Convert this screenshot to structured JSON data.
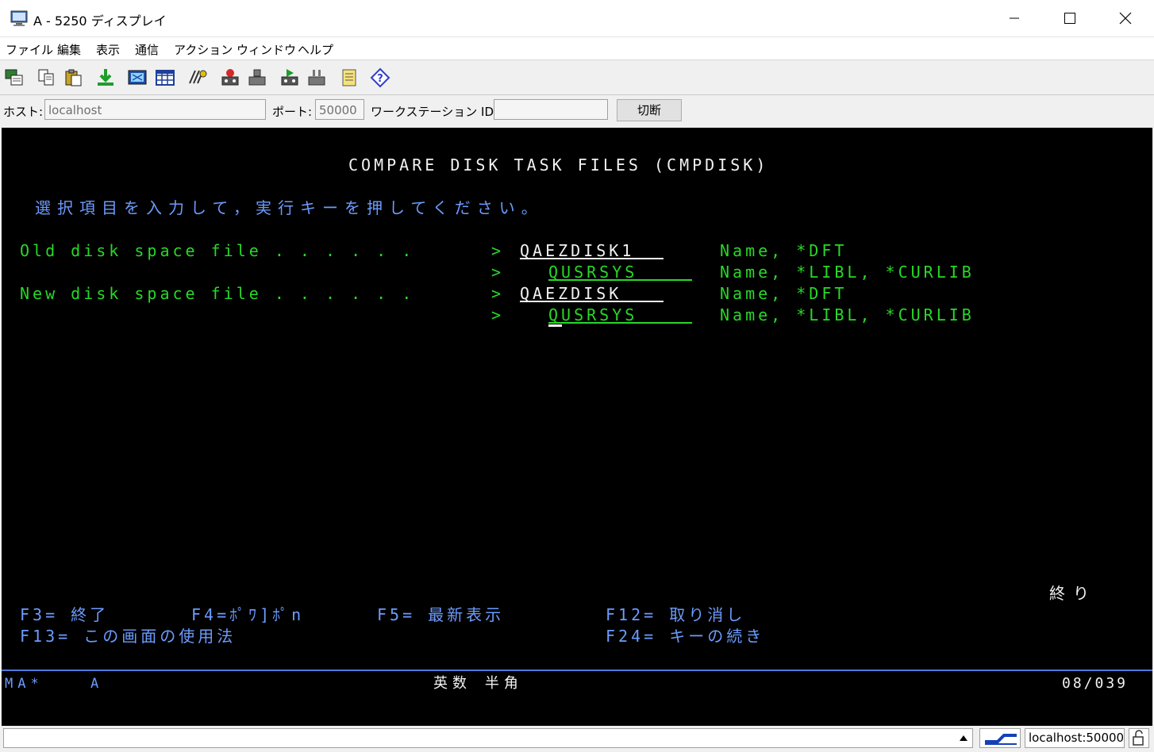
{
  "window": {
    "title": "A - 5250 ディスプレイ"
  },
  "menu": [
    "ファイル",
    "編集",
    "表示",
    "通信",
    "アクション",
    "ウィンドウ",
    "ヘルプ"
  ],
  "toolbar_icons": [
    "copy-screen-icon",
    "copy-icon",
    "paste-icon",
    "download-icon",
    "receive-icon",
    "grid-icon",
    "macro-icon",
    "record-icon",
    "stop-icon",
    "play-icon",
    "pause-icon",
    "notes-icon",
    "help-icon"
  ],
  "connection": {
    "host_label": "ホスト:",
    "host_value": "localhost",
    "port_label": "ポート:",
    "port_value": "50000",
    "ws_label": "ワークステーション ID:",
    "ws_value": "",
    "disconnect": "切断"
  },
  "screen": {
    "title": "COMPARE DISK TASK FILES (CMPDISK)",
    "instruction": "選択項目を入力して，実行キーを押してください。",
    "rows": [
      {
        "label": "Old disk space file . . . . . .",
        "prompt": ">",
        "value": "QAEZDISK1",
        "hint": "Name, *DFT"
      },
      {
        "label": "",
        "prompt": ">",
        "value": "QUSRSYS",
        "hint": "Name, *LIBL, *CURLIB"
      },
      {
        "label": "New disk space file . . . . . .",
        "prompt": ">",
        "value": "QAEZDISK",
        "hint": "Name, *DFT"
      },
      {
        "label": "",
        "prompt": ">",
        "value": "QUSRSYS",
        "hint": "Name, *LIBL, *CURLIB"
      }
    ],
    "more": "終り",
    "fkeys": {
      "f3": "F3= 終了",
      "f4": "F4=ﾎﾟﾜ]ﾎﾟn",
      "f5": "F5= 最新表示",
      "f12": "F12= 取り消し",
      "f13": "F13= この画面の使用法",
      "f24": "F24= キーの続き"
    },
    "oia": {
      "left": "MA*",
      "mode": "A",
      "input": "英数 半角",
      "cursor": "08/039"
    }
  },
  "status": {
    "host": "localhost:50000"
  },
  "colors": {
    "green": "#28d828",
    "white": "#f2f2f2",
    "blue": "#6c9cff",
    "oia_line": "#4d7bdc"
  }
}
